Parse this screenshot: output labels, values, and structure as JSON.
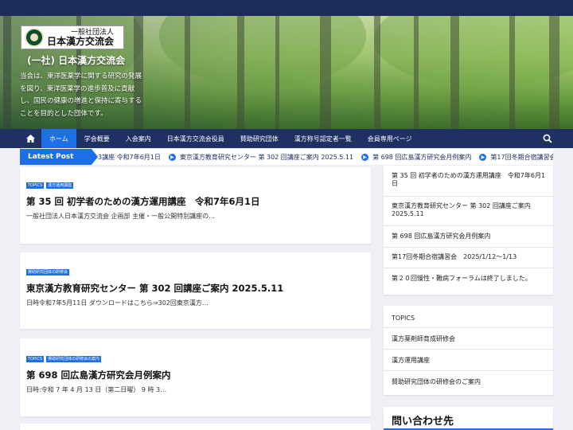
{
  "header": {
    "logo_line1": "一般社団法人",
    "logo_line2": "日本漢方交流会",
    "site_title": "(一社) 日本漢方交流会",
    "description": "当会は、東洋医薬学に関する研究の発展を図り、東洋医薬学の進歩普及に貢献し、国民の健康の増進と保持に寄与することを目的とした団体です。"
  },
  "nav": {
    "home_icon": "home-icon",
    "items": [
      {
        "label": "ホーム",
        "active": true
      },
      {
        "label": "学会概要"
      },
      {
        "label": "入会案内"
      },
      {
        "label": "日本漢方交流会役員"
      },
      {
        "label": "賛助研究団体"
      },
      {
        "label": "漢方称号認定者一覧"
      },
      {
        "label": "会員専用ページ"
      }
    ],
    "search_icon": "search-icon"
  },
  "ticker": {
    "label": "Latest Post",
    "items": [
      "3講座 令和7年6月1日",
      "東京漢方教育研究センター 第 302 回講座ご案内 2025.5.11",
      "第 698 回広島漢方研究会月例案内",
      "第17回冬期合宿講習会"
    ]
  },
  "posts": [
    {
      "tags": [
        "TOPICS",
        "漢方運用講座"
      ],
      "title": "第 35 回 初学者のための漢方運用講座　令和7年6月1日",
      "excerpt": "一般社団法人日本漢方交流会 企画部 主催・一般公開特別講座の…"
    },
    {
      "tags": [
        "賛助研究団体の研修会"
      ],
      "title": "東京漢方教育研究センター 第 302 回講座ご案内 2025.5.11",
      "excerpt": "日時令和7年5月11日 ダウンロードはこちら⇒302回東京漢方…"
    },
    {
      "tags": [
        "TOPICS",
        "賛助研究団体の研修会の案内"
      ],
      "title": "第 698 回広島漢方研究会月例案内",
      "excerpt": "日時:令和 7 年 4 月 13 日（第二日曜） 9 時 3…"
    }
  ],
  "sidebar": {
    "recent_posts": [
      "第 35 回 初学者のための漢方運用講座　令和7年6月1日",
      "東京漢方教育研究センター 第 302 回講座ご案内 2025.5.11",
      "第 698 回広島漢方研究会月例案内",
      "第17回冬期合宿講習会　2025/1/12〜1/13",
      "第２０回慢性・難病フォーラムは終了しました。"
    ],
    "categories": [
      "TOPICS",
      "漢方薬剤師育成研修会",
      "漢方運用講座",
      "賛助研究団体の研修会のご案内"
    ],
    "contact_title": "問い合わせ先"
  },
  "colors": {
    "nav_bg": "#1f3163",
    "accent": "#1e6ee6",
    "page_bg": "#eef0f5"
  }
}
